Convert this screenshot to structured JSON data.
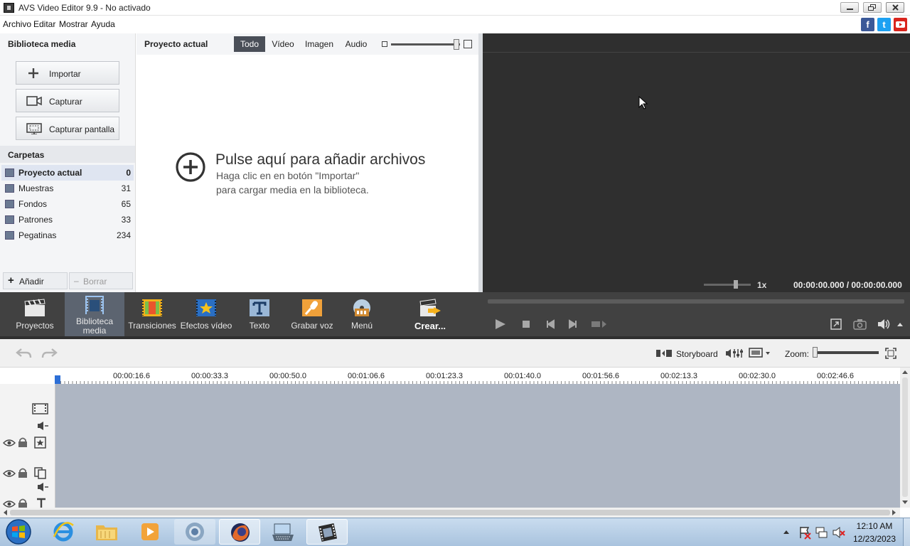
{
  "window": {
    "title": "AVS Video Editor 9.9 - No activado"
  },
  "menu": [
    "Archivo",
    "Editar",
    "Mostrar",
    "Ayuda"
  ],
  "social": {
    "facebook": "f",
    "twitter": "t"
  },
  "library": {
    "header": "Biblioteca media",
    "buttons": {
      "import": "Importar",
      "capture": "Capturar",
      "screen": "Capturar pantalla"
    },
    "folders_header": "Carpetas",
    "folders": [
      {
        "name": "Proyecto actual",
        "count": "0"
      },
      {
        "name": "Muestras",
        "count": "31"
      },
      {
        "name": "Fondos",
        "count": "65"
      },
      {
        "name": "Patrones",
        "count": "33"
      },
      {
        "name": "Pegatinas",
        "count": "234"
      }
    ],
    "add": "Añadir",
    "delete": "Borrar"
  },
  "center": {
    "header": "Proyecto actual",
    "tabs": [
      "Todo",
      "Vídeo",
      "Imagen",
      "Audio"
    ],
    "drop_title": "Pulse aquí para añadir archivos",
    "drop_line1": "Haga clic en en botón \"Importar\"",
    "drop_line2": "para cargar media en la biblioteca."
  },
  "preview": {
    "speed": "1x",
    "time": "00:00:00.000 / 00:00:00.000"
  },
  "toolbar": {
    "projects": "Proyectos",
    "media_line1": "Biblioteca",
    "media_line2": "media",
    "transitions": "Transiciones",
    "effects": "Efectos vídeo",
    "text": "Texto",
    "voice": "Grabar voz",
    "menu": "Menú",
    "create": "Crear..."
  },
  "timeline": {
    "storyboard": "Storyboard",
    "zoom": "Zoom:",
    "ticks": [
      "00:00:16.6",
      "00:00:33.3",
      "00:00:50.0",
      "00:01:06.6",
      "00:01:23.3",
      "00:01:40.0",
      "00:01:56.6",
      "00:02:13.3",
      "00:02:30.0",
      "00:02:46.6"
    ]
  },
  "taskbar": {
    "time": "12:10 AM",
    "date": "12/23/2023"
  },
  "colors": {
    "accent": "#5c6470",
    "preview_bg": "#2f2f2f",
    "toolbar_bg": "#414141",
    "tracks_bg": "#aeb6c3"
  }
}
